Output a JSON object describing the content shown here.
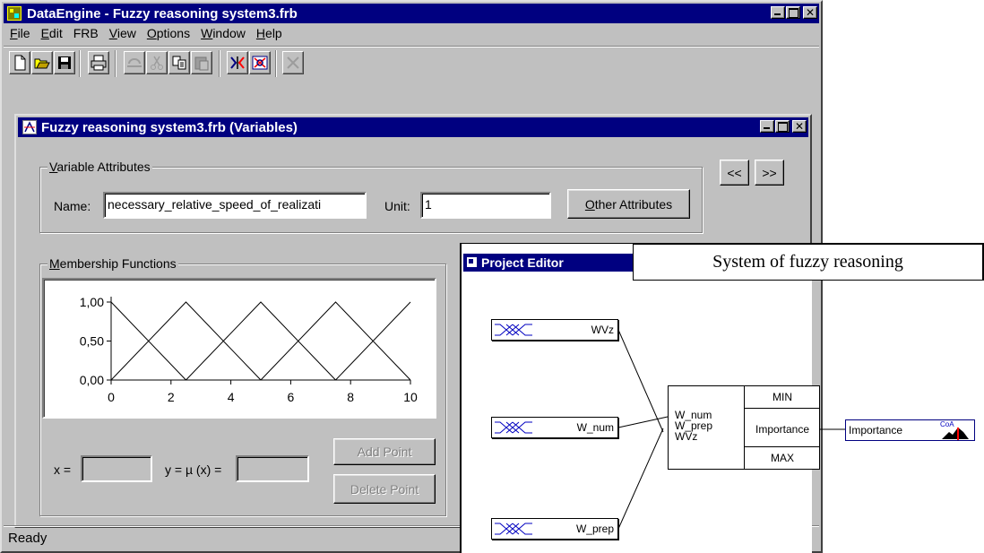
{
  "app": {
    "title": "DataEngine - Fuzzy reasoning system3.frb",
    "menu": [
      {
        "label": "File",
        "u": "F",
        "rest": "ile"
      },
      {
        "label": "Edit",
        "u": "E",
        "rest": "dit"
      },
      {
        "label": "FRB",
        "u": "F",
        "rest": "RB",
        "u_index": 1
      },
      {
        "label": "View",
        "u": "V",
        "rest": "iew"
      },
      {
        "label": "Options",
        "u": "O",
        "rest": "ptions"
      },
      {
        "label": "Window",
        "u": "W",
        "rest": "indow"
      },
      {
        "label": "Help",
        "u": "H",
        "rest": "elp"
      }
    ],
    "toolbar": [
      "new-document-icon",
      "open-folder-icon",
      "save-icon",
      "print-icon",
      "undo-icon",
      "cut-icon",
      "copy-icon",
      "paste-icon",
      "edit-rule-icon",
      "inspect-icon",
      "delete-icon"
    ],
    "status": "Ready",
    "colors": {
      "titlebar": "#000080",
      "face": "#c0c0c0"
    }
  },
  "variables_window": {
    "title": "Fuzzy reasoning system3.frb (Variables)",
    "attributes_legend": "Variable Attributes",
    "name_label": "Name:",
    "name_value": "necessary_relative_speed_of_realizati",
    "unit_label": "Unit:",
    "unit_value": "1",
    "other_attributes": "Other Attributes",
    "prev_button": "<<",
    "next_button": ">>",
    "membership_legend": "Membership Functions",
    "x_label": "x =",
    "y_label": "y = µ (x) =",
    "add_point": "Add Point",
    "delete_point": "Delete Point"
  },
  "chart_data": {
    "type": "line",
    "title": "",
    "xlabel": "",
    "ylabel": "",
    "xlim": [
      0,
      10
    ],
    "ylim": [
      0,
      1
    ],
    "x_ticks": [
      "0",
      "2",
      "4",
      "6",
      "8",
      "10"
    ],
    "y_ticks": [
      "1,00",
      "0,50",
      "0,00"
    ],
    "series": [
      {
        "x": [
          0,
          2.5
        ],
        "y": [
          1,
          0
        ]
      },
      {
        "x": [
          0,
          2.5,
          5
        ],
        "y": [
          0,
          1,
          0
        ]
      },
      {
        "x": [
          2.5,
          5,
          7.5
        ],
        "y": [
          0,
          1,
          0
        ]
      },
      {
        "x": [
          5,
          7.5,
          10
        ],
        "y": [
          0,
          1,
          0
        ]
      },
      {
        "x": [
          7.5,
          10
        ],
        "y": [
          0,
          1
        ]
      }
    ]
  },
  "project_editor": {
    "title": "Project Editor",
    "caption": "System of fuzzy reasoning",
    "inputs": [
      "WVz",
      "W_num",
      "W_prep"
    ],
    "rule_inputs": [
      "W_num",
      "W_prep",
      "WVz"
    ],
    "rule_ops": {
      "top": "MIN",
      "middle": "Importance",
      "bottom": "MAX"
    },
    "output": {
      "label": "Importance",
      "method": "CoA"
    }
  }
}
